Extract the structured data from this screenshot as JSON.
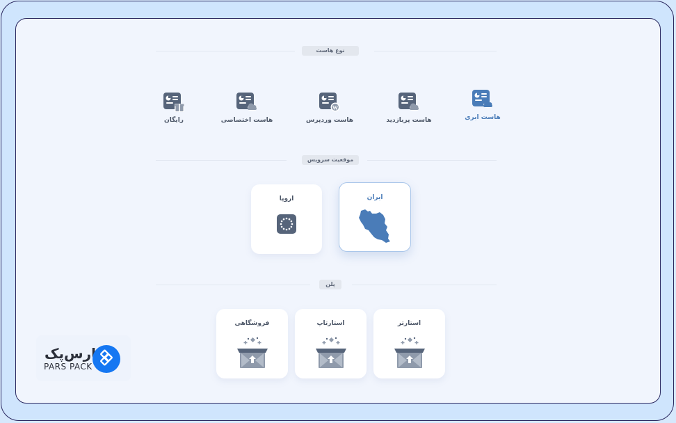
{
  "sections": {
    "host_type": "نوع هاست",
    "service_location": "موقعیت سرویس",
    "plan": "پلن"
  },
  "host_types": [
    {
      "label": "هاست ابری",
      "icon": "cloud-host-icon",
      "selected": true
    },
    {
      "label": "هاست پربازدید",
      "icon": "high-traffic-host-icon",
      "selected": false
    },
    {
      "label": "هاست وردپرس",
      "icon": "wordpress-host-icon",
      "selected": false
    },
    {
      "label": "هاست اختصاصی",
      "icon": "dedicated-host-icon",
      "selected": false
    },
    {
      "label": "رایگان",
      "icon": "free-host-gift-icon",
      "selected": false
    }
  ],
  "locations": [
    {
      "label": "ایران",
      "icon": "iran-map-icon",
      "selected": true
    },
    {
      "label": "اروپا",
      "icon": "eu-flag-icon",
      "selected": false
    }
  ],
  "plans": [
    {
      "label": "استارتر",
      "icon": "open-box-icon"
    },
    {
      "label": "استارتاپ",
      "icon": "open-box-icon"
    },
    {
      "label": "فروشگاهی",
      "icon": "open-box-icon"
    }
  ],
  "logo": {
    "fa": "پارس‌پک",
    "en": "PARS PACK"
  },
  "colors": {
    "accent": "#4a7cb8",
    "icon_dark": "#56647a",
    "logo_blue": "#1577f2",
    "frame": "#2a2860"
  }
}
